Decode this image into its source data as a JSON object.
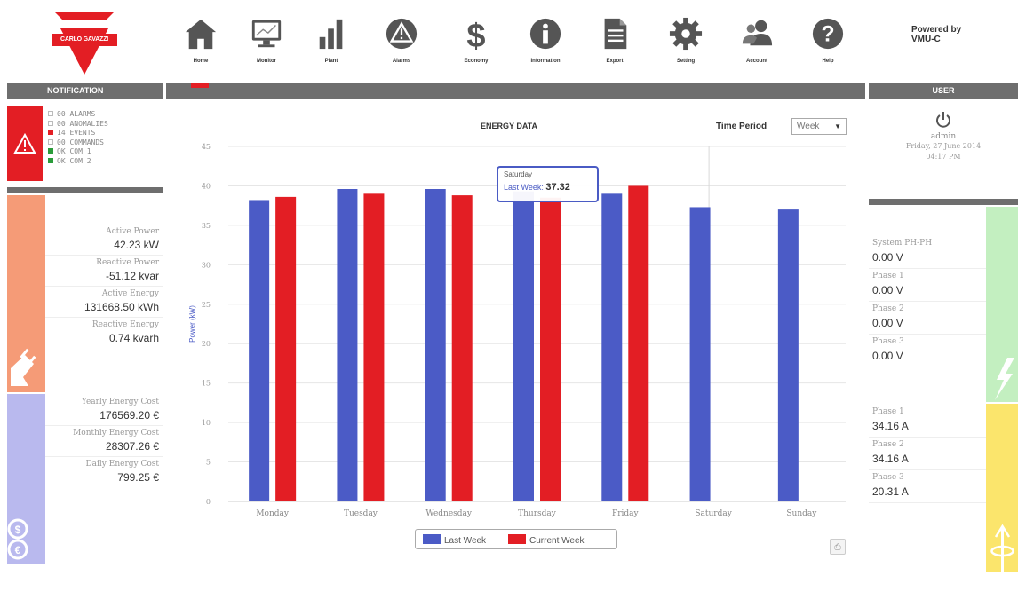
{
  "brand": {
    "logo_text": "CARLO GAVAZZI",
    "powered_by": "Powered by",
    "powered_product": "VMU-C"
  },
  "nav": [
    {
      "label": "Home",
      "icon": "home-icon"
    },
    {
      "label": "Monitor",
      "icon": "monitor-icon"
    },
    {
      "label": "Plant",
      "icon": "plant-icon"
    },
    {
      "label": "Alarms",
      "icon": "alarm-icon"
    },
    {
      "label": "Economy",
      "icon": "dollar-icon"
    },
    {
      "label": "Information",
      "icon": "info-icon"
    },
    {
      "label": "Export",
      "icon": "document-icon"
    },
    {
      "label": "Setting",
      "icon": "gear-icon"
    },
    {
      "label": "Account",
      "icon": "users-icon"
    },
    {
      "label": "Help",
      "icon": "help-icon"
    }
  ],
  "headers": {
    "notification": "NOTIFICATION",
    "user": "USER"
  },
  "notifications": [
    {
      "count": "00",
      "label": "ALARMS",
      "status": "none"
    },
    {
      "count": "00",
      "label": "ANOMALIES",
      "status": "none"
    },
    {
      "count": "14",
      "label": "EVENTS",
      "status": "red"
    },
    {
      "count": "00",
      "label": "COMMANDS",
      "status": "none"
    },
    {
      "count": "OK",
      "label": "COM 1",
      "status": "green"
    },
    {
      "count": "OK",
      "label": "COM 2",
      "status": "green"
    }
  ],
  "power": {
    "active_power_label": "Active Power",
    "active_power": "42.23 kW",
    "reactive_power_label": "Reactive Power",
    "reactive_power": "-51.12 kvar",
    "active_energy_label": "Active Energy",
    "active_energy": "131668.50 kWh",
    "reactive_energy_label": "Reactive Energy",
    "reactive_energy": "0.74 kvarh"
  },
  "costs": {
    "yearly_label": "Yearly Energy Cost",
    "yearly": "176569.20 €",
    "monthly_label": "Monthly Energy Cost",
    "monthly": "28307.26 €",
    "daily_label": "Daily Energy Cost",
    "daily": "799.25 €"
  },
  "chart_panel": {
    "title": "ENERGY DATA",
    "period_label": "Time Period",
    "period_value": "Week",
    "tooltip": {
      "day": "Saturday",
      "series": "Last Week",
      "value": "37.32"
    }
  },
  "chart_data": {
    "type": "bar",
    "ylabel": "Power (kW)",
    "ylim": [
      0,
      45
    ],
    "yticks": [
      0,
      5,
      10,
      15,
      20,
      25,
      30,
      35,
      40,
      45
    ],
    "categories": [
      "Monday",
      "Tuesday",
      "Wednesday",
      "Thursday",
      "Friday",
      "Saturday",
      "Sunday"
    ],
    "series": [
      {
        "name": "Last Week",
        "color": "#4b5bc6",
        "values": [
          38.2,
          39.6,
          39.6,
          39.3,
          39.0,
          37.3,
          37.0
        ]
      },
      {
        "name": "Current Week",
        "color": "#e31e24",
        "values": [
          38.6,
          39.0,
          38.8,
          38.5,
          40.0,
          null,
          null
        ]
      }
    ],
    "grid": true,
    "legend": "bottom-center"
  },
  "user": {
    "name": "admin",
    "date": "Friday, 27 June 2014",
    "time": "04:17 PM"
  },
  "voltage": {
    "system_label": "System PH-PH",
    "system": "0.00 V",
    "p1_label": "Phase 1",
    "p1": "0.00 V",
    "p2_label": "Phase 2",
    "p2": "0.00 V",
    "p3_label": "Phase 3",
    "p3": "0.00 V"
  },
  "current": {
    "p1_label": "Phase 1",
    "p1": "34.16 A",
    "p2_label": "Phase 2",
    "p2": "34.16 A",
    "p3_label": "Phase 3",
    "p3": "20.31 A"
  },
  "colors": {
    "brand_red": "#e31e24",
    "header_grey": "#6e6e6e",
    "series_blue": "#4b5bc6"
  }
}
